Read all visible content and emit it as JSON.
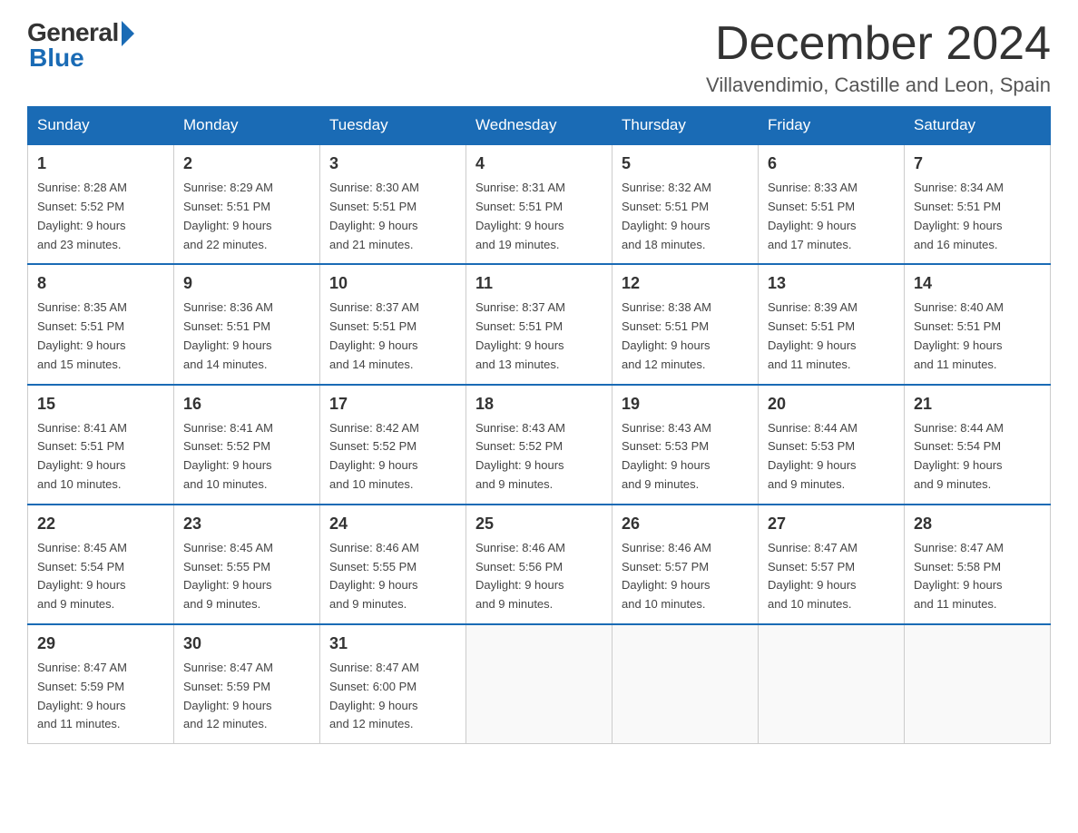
{
  "logo": {
    "general": "General",
    "blue": "Blue"
  },
  "header": {
    "month": "December 2024",
    "location": "Villavendimio, Castille and Leon, Spain"
  },
  "weekdays": [
    "Sunday",
    "Monday",
    "Tuesday",
    "Wednesday",
    "Thursday",
    "Friday",
    "Saturday"
  ],
  "weeks": [
    [
      {
        "day": "1",
        "sunrise": "8:28 AM",
        "sunset": "5:52 PM",
        "daylight_hours": "9",
        "daylight_minutes": "23"
      },
      {
        "day": "2",
        "sunrise": "8:29 AM",
        "sunset": "5:51 PM",
        "daylight_hours": "9",
        "daylight_minutes": "22"
      },
      {
        "day": "3",
        "sunrise": "8:30 AM",
        "sunset": "5:51 PM",
        "daylight_hours": "9",
        "daylight_minutes": "21"
      },
      {
        "day": "4",
        "sunrise": "8:31 AM",
        "sunset": "5:51 PM",
        "daylight_hours": "9",
        "daylight_minutes": "19"
      },
      {
        "day": "5",
        "sunrise": "8:32 AM",
        "sunset": "5:51 PM",
        "daylight_hours": "9",
        "daylight_minutes": "18"
      },
      {
        "day": "6",
        "sunrise": "8:33 AM",
        "sunset": "5:51 PM",
        "daylight_hours": "9",
        "daylight_minutes": "17"
      },
      {
        "day": "7",
        "sunrise": "8:34 AM",
        "sunset": "5:51 PM",
        "daylight_hours": "9",
        "daylight_minutes": "16"
      }
    ],
    [
      {
        "day": "8",
        "sunrise": "8:35 AM",
        "sunset": "5:51 PM",
        "daylight_hours": "9",
        "daylight_minutes": "15"
      },
      {
        "day": "9",
        "sunrise": "8:36 AM",
        "sunset": "5:51 PM",
        "daylight_hours": "9",
        "daylight_minutes": "14"
      },
      {
        "day": "10",
        "sunrise": "8:37 AM",
        "sunset": "5:51 PM",
        "daylight_hours": "9",
        "daylight_minutes": "14"
      },
      {
        "day": "11",
        "sunrise": "8:37 AM",
        "sunset": "5:51 PM",
        "daylight_hours": "9",
        "daylight_minutes": "13"
      },
      {
        "day": "12",
        "sunrise": "8:38 AM",
        "sunset": "5:51 PM",
        "daylight_hours": "9",
        "daylight_minutes": "12"
      },
      {
        "day": "13",
        "sunrise": "8:39 AM",
        "sunset": "5:51 PM",
        "daylight_hours": "9",
        "daylight_minutes": "11"
      },
      {
        "day": "14",
        "sunrise": "8:40 AM",
        "sunset": "5:51 PM",
        "daylight_hours": "9",
        "daylight_minutes": "11"
      }
    ],
    [
      {
        "day": "15",
        "sunrise": "8:41 AM",
        "sunset": "5:51 PM",
        "daylight_hours": "9",
        "daylight_minutes": "10"
      },
      {
        "day": "16",
        "sunrise": "8:41 AM",
        "sunset": "5:52 PM",
        "daylight_hours": "9",
        "daylight_minutes": "10"
      },
      {
        "day": "17",
        "sunrise": "8:42 AM",
        "sunset": "5:52 PM",
        "daylight_hours": "9",
        "daylight_minutes": "10"
      },
      {
        "day": "18",
        "sunrise": "8:43 AM",
        "sunset": "5:52 PM",
        "daylight_hours": "9",
        "daylight_minutes": "9"
      },
      {
        "day": "19",
        "sunrise": "8:43 AM",
        "sunset": "5:53 PM",
        "daylight_hours": "9",
        "daylight_minutes": "9"
      },
      {
        "day": "20",
        "sunrise": "8:44 AM",
        "sunset": "5:53 PM",
        "daylight_hours": "9",
        "daylight_minutes": "9"
      },
      {
        "day": "21",
        "sunrise": "8:44 AM",
        "sunset": "5:54 PM",
        "daylight_hours": "9",
        "daylight_minutes": "9"
      }
    ],
    [
      {
        "day": "22",
        "sunrise": "8:45 AM",
        "sunset": "5:54 PM",
        "daylight_hours": "9",
        "daylight_minutes": "9"
      },
      {
        "day": "23",
        "sunrise": "8:45 AM",
        "sunset": "5:55 PM",
        "daylight_hours": "9",
        "daylight_minutes": "9"
      },
      {
        "day": "24",
        "sunrise": "8:46 AM",
        "sunset": "5:55 PM",
        "daylight_hours": "9",
        "daylight_minutes": "9"
      },
      {
        "day": "25",
        "sunrise": "8:46 AM",
        "sunset": "5:56 PM",
        "daylight_hours": "9",
        "daylight_minutes": "9"
      },
      {
        "day": "26",
        "sunrise": "8:46 AM",
        "sunset": "5:57 PM",
        "daylight_hours": "9",
        "daylight_minutes": "10"
      },
      {
        "day": "27",
        "sunrise": "8:47 AM",
        "sunset": "5:57 PM",
        "daylight_hours": "9",
        "daylight_minutes": "10"
      },
      {
        "day": "28",
        "sunrise": "8:47 AM",
        "sunset": "5:58 PM",
        "daylight_hours": "9",
        "daylight_minutes": "11"
      }
    ],
    [
      {
        "day": "29",
        "sunrise": "8:47 AM",
        "sunset": "5:59 PM",
        "daylight_hours": "9",
        "daylight_minutes": "11"
      },
      {
        "day": "30",
        "sunrise": "8:47 AM",
        "sunset": "5:59 PM",
        "daylight_hours": "9",
        "daylight_minutes": "12"
      },
      {
        "day": "31",
        "sunrise": "8:47 AM",
        "sunset": "6:00 PM",
        "daylight_hours": "9",
        "daylight_minutes": "12"
      },
      null,
      null,
      null,
      null
    ]
  ]
}
